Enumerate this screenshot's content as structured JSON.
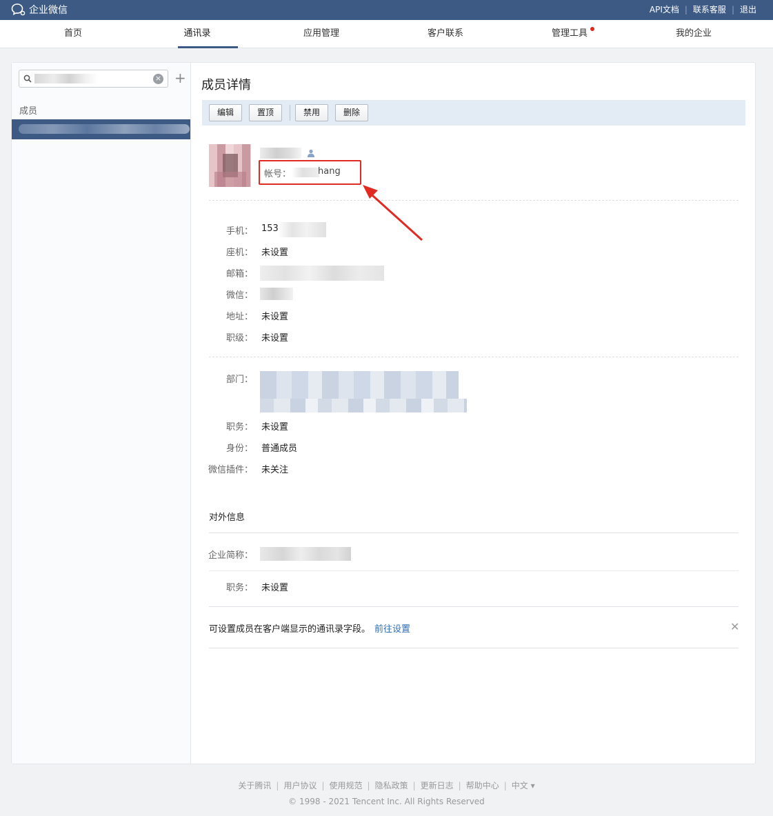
{
  "topbar": {
    "logo_text": "企业微信",
    "links": [
      "API文档",
      "联系客服",
      "退出"
    ]
  },
  "nav": {
    "items": [
      "首页",
      "通讯录",
      "应用管理",
      "客户联系",
      "管理工具",
      "我的企业"
    ],
    "active": "通讯录"
  },
  "sidebar": {
    "section_label": "成员",
    "add_label": "+"
  },
  "detail": {
    "title": "成员详情",
    "toolbar": [
      "编辑",
      "置顶",
      "禁用",
      "删除"
    ],
    "account_label": "帐号：",
    "account_visible_suffix": "hang",
    "fields": {
      "mobile_label": "手机：",
      "mobile_value": "153",
      "landline_label": "座机：",
      "landline_value": "未设置",
      "email_label": "邮箱：",
      "wechat_label": "微信：",
      "address_label": "地址：",
      "address_value": "未设置",
      "rank_label": "职级：",
      "rank_value": "未设置",
      "dept_label": "部门：",
      "position_label": "职务：",
      "position_value": "未设置",
      "identity_label": "身份：",
      "identity_value": "普通成员",
      "plugin_label": "微信插件：",
      "plugin_value": "未关注"
    },
    "external": {
      "title": "对外信息",
      "company_label": "企业简称：",
      "position_label": "职务：",
      "position_value": "未设置"
    },
    "tip": {
      "text": "可设置成员在客户端显示的通讯录字段。",
      "link": "前往设置",
      "close": "✕"
    }
  },
  "footer": {
    "links": [
      "关于腾讯",
      "用户协议",
      "使用规范",
      "隐私政策",
      "更新日志",
      "帮助中心",
      "中文 ▾"
    ],
    "copyright": "© 1998 - 2021 Tencent Inc. All Rights Reserved"
  },
  "colors": {
    "brand": "#3d5a84",
    "toolbar_bg": "#e3ecf5",
    "annotation": "#e02a22",
    "link": "#2d6eb4",
    "notification_dot": "#e0281c"
  },
  "icons": {
    "logo": "chat-bubble-icon",
    "search": "search-icon",
    "clear": "clear-icon",
    "add": "plus-icon",
    "member_type": "user-icon",
    "close": "close-icon"
  }
}
